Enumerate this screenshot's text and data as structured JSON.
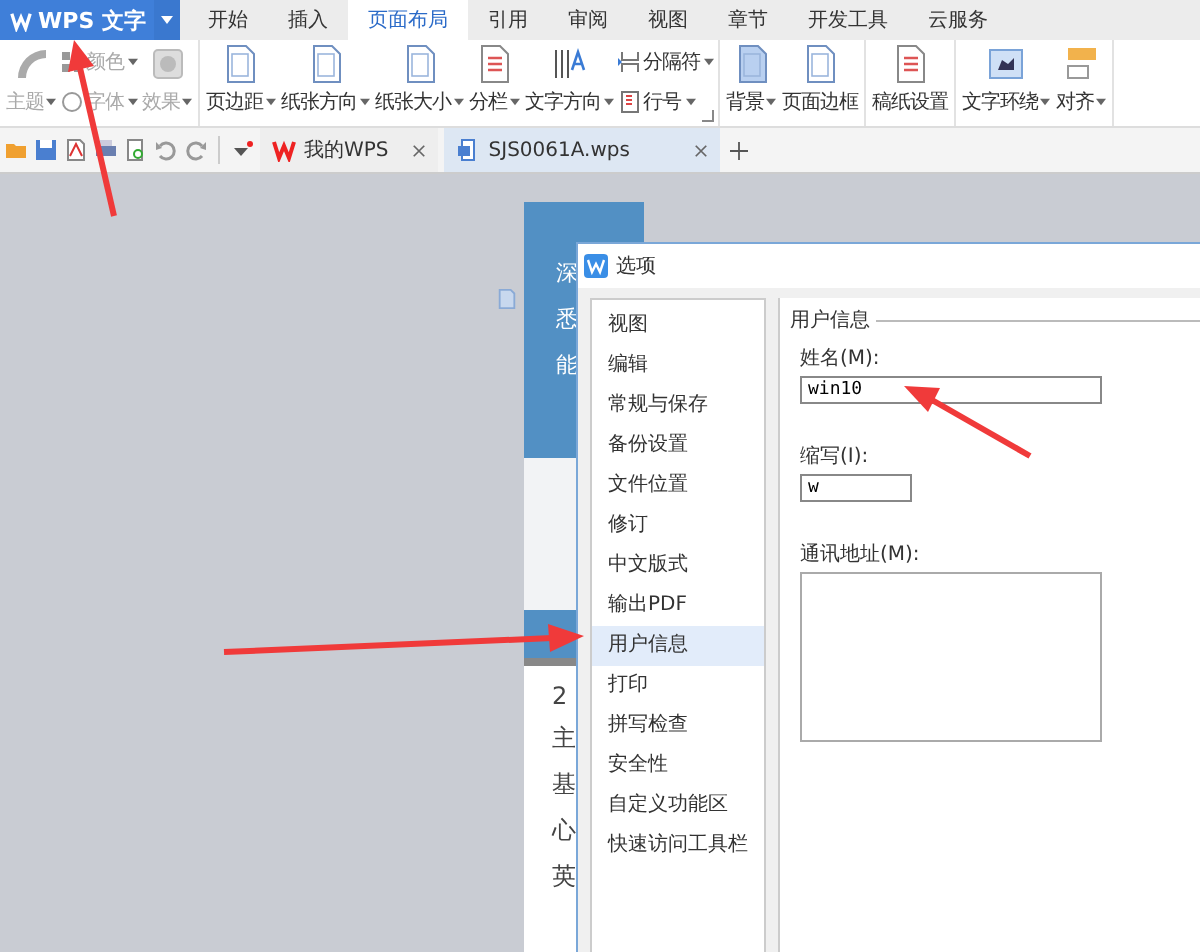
{
  "app_button": {
    "label": "WPS 文字"
  },
  "tabs": [
    {
      "label": "开始",
      "selected": false
    },
    {
      "label": "插入",
      "selected": false
    },
    {
      "label": "页面布局",
      "selected": true
    },
    {
      "label": "引用",
      "selected": false
    },
    {
      "label": "审阅",
      "selected": false
    },
    {
      "label": "视图",
      "selected": false
    },
    {
      "label": "章节",
      "selected": false
    },
    {
      "label": "开发工具",
      "selected": false
    },
    {
      "label": "云服务",
      "selected": false
    }
  ],
  "ribbon": {
    "groups": [
      {
        "items": [
          {
            "kind": "big",
            "label": "主题",
            "dropdown": true,
            "disabled": true
          },
          {
            "kind": "small",
            "label": "颜色",
            "dropdown": true,
            "disabled": true
          },
          {
            "kind": "small",
            "label": "字体",
            "dropdown": true,
            "disabled": true
          },
          {
            "kind": "big",
            "label": "效果",
            "dropdown": true,
            "disabled": true
          }
        ]
      },
      {
        "items": [
          {
            "kind": "big",
            "label": "页边距",
            "dropdown": true,
            "disabled": false
          },
          {
            "kind": "big",
            "label": "纸张方向",
            "dropdown": true,
            "disabled": false
          },
          {
            "kind": "big",
            "label": "纸张大小",
            "dropdown": true,
            "disabled": false
          },
          {
            "kind": "big",
            "label": "分栏",
            "dropdown": true,
            "disabled": false
          },
          {
            "kind": "big",
            "label": "文字方向",
            "dropdown": true,
            "disabled": false
          },
          {
            "kind": "small",
            "label": "分隔符",
            "dropdown": true,
            "disabled": false
          },
          {
            "kind": "small",
            "label": "行号",
            "dropdown": true,
            "disabled": false
          },
          {
            "kind": "launcher"
          }
        ]
      },
      {
        "items": [
          {
            "kind": "big",
            "label": "背景",
            "dropdown": true,
            "disabled": false
          },
          {
            "kind": "big",
            "label": "页面边框",
            "dropdown": false,
            "disabled": false
          }
        ]
      },
      {
        "items": [
          {
            "kind": "big",
            "label": "稿纸设置",
            "dropdown": false,
            "disabled": false
          }
        ]
      },
      {
        "items": [
          {
            "kind": "big",
            "label": "文字环绕",
            "dropdown": true,
            "disabled": false
          },
          {
            "kind": "big",
            "label": "对齐",
            "dropdown": true,
            "disabled": false
          }
        ]
      }
    ]
  },
  "doc_tabs": [
    {
      "label": "我的WPS",
      "selected": false
    },
    {
      "label": "SJS0061A.wps",
      "selected": true
    }
  ],
  "document": {
    "header_lines": [
      "深",
      "悉",
      "能"
    ],
    "body_lines": [
      "2",
      "主",
      "基",
      "心",
      "英"
    ]
  },
  "dialog": {
    "title": "选项",
    "nav": [
      {
        "label": "视图",
        "selected": false
      },
      {
        "label": "编辑",
        "selected": false
      },
      {
        "label": "常规与保存",
        "selected": false
      },
      {
        "label": "备份设置",
        "selected": false
      },
      {
        "label": "文件位置",
        "selected": false
      },
      {
        "label": "修订",
        "selected": false
      },
      {
        "label": "中文版式",
        "selected": false
      },
      {
        "label": "输出PDF",
        "selected": false
      },
      {
        "label": "用户信息",
        "selected": true
      },
      {
        "label": "打印",
        "selected": false
      },
      {
        "label": "拼写检查",
        "selected": false
      },
      {
        "label": "安全性",
        "selected": false
      },
      {
        "label": "自定义功能区",
        "selected": false
      },
      {
        "label": "快速访问工具栏",
        "selected": false
      }
    ],
    "section_title": "用户信息",
    "fields": [
      {
        "kind": "line",
        "label": "姓名(M):",
        "value": "win10"
      },
      {
        "kind": "short",
        "label": "缩写(I):",
        "value": "w"
      },
      {
        "kind": "area",
        "label": "通讯地址(M):"
      }
    ]
  }
}
